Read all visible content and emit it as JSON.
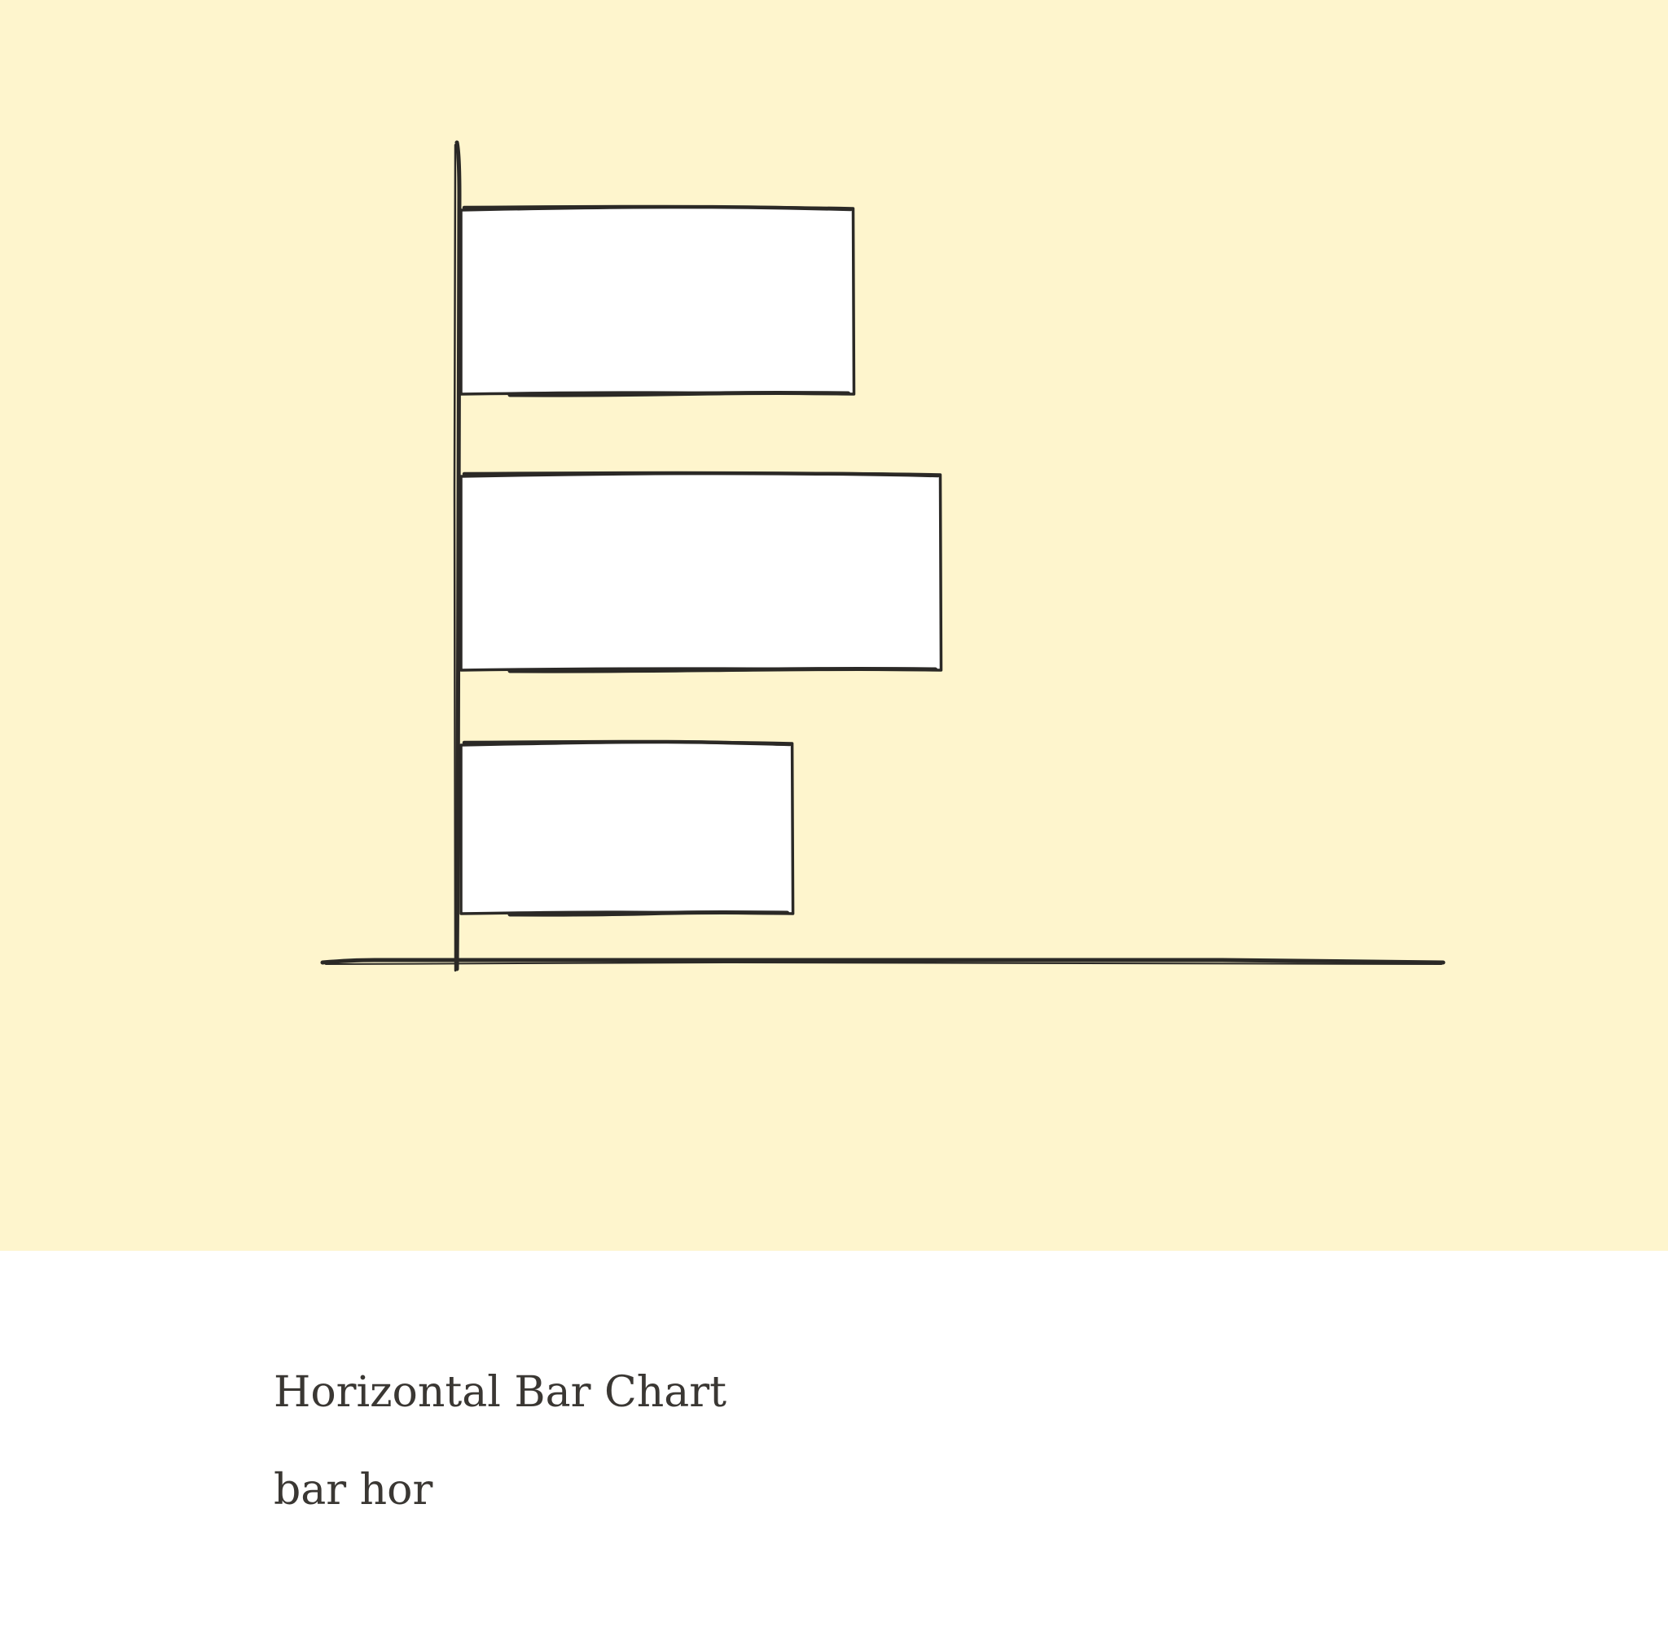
{
  "card": {
    "title": "Horizontal Bar Chart",
    "tag": "bar hor"
  },
  "illustration": {
    "type": "bar",
    "orientation": "horizontal",
    "values": [
      0.45,
      0.55,
      0.38
    ],
    "style": "hand-drawn sketch",
    "colors": {
      "background": "#fef5cd",
      "bar_fill": "#ffffff",
      "stroke": "#2b2926"
    }
  }
}
